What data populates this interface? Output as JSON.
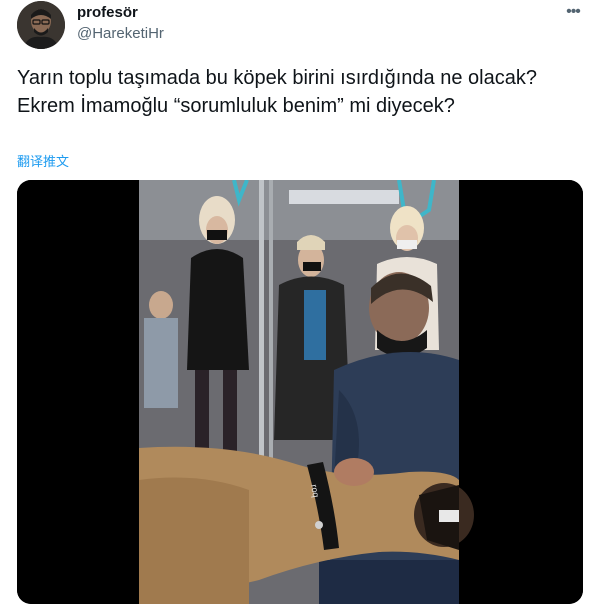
{
  "author": {
    "display_name": "profesör",
    "handle": "@HareketiHr",
    "avatar_icon": "avatar-portrait-icon"
  },
  "more_icon": "more-dots-icon",
  "tweet": {
    "text": "Yarın toplu taşımada bu köpek birini ısırdığında ne olacak? Ekrem İmamoğlu “sorumluluk benim” mi diyecek?",
    "translate_label": "翻译推文"
  },
  "media": {
    "type": "video-frame",
    "collar_text": "roq"
  },
  "colors": {
    "link": "#1d9bf0",
    "secondary_text": "#536471",
    "primary_text": "#0f1419"
  }
}
